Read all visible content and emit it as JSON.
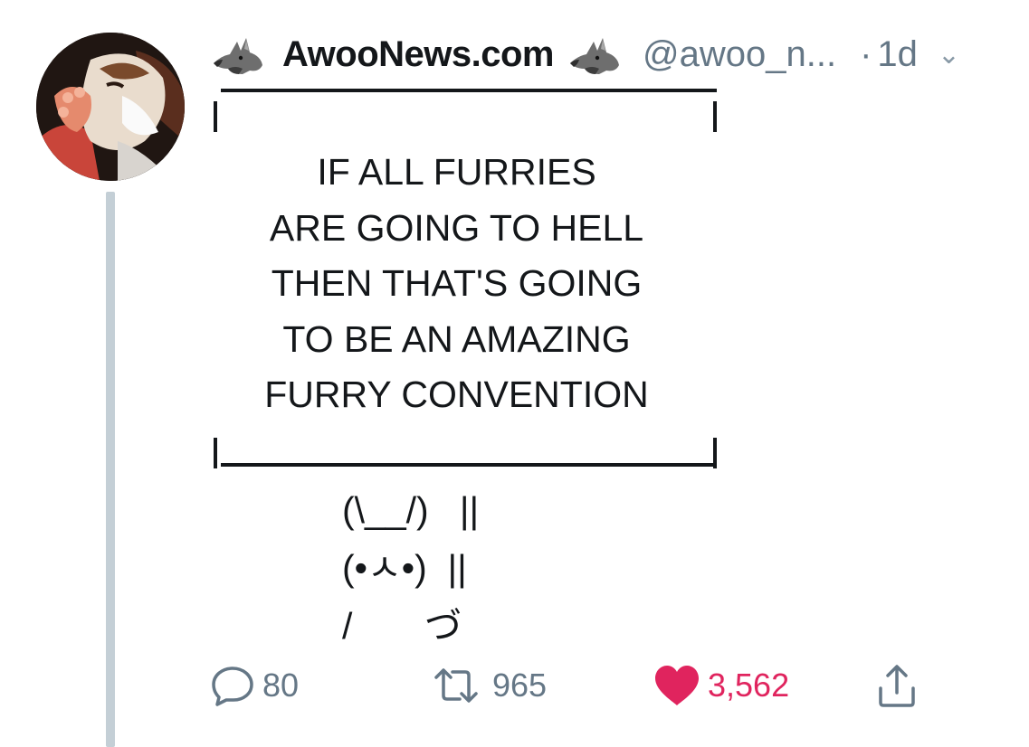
{
  "tweet": {
    "author": {
      "display_name": "AwooNews.com",
      "name_prefix_icon": "wolf-emoji-icon",
      "name_suffix_icon": "wolf-emoji-icon",
      "handle": "@awoo_n...",
      "separator": "·",
      "age": "1d",
      "avatar_icon": "furry-character-avatar"
    },
    "menu_icon": "chevron-down-icon",
    "body": {
      "sign_lines": [
        "IF ALL FURRIES",
        "ARE GOING TO HELL",
        "THEN THAT'S GOING",
        "TO BE AN AMAZING",
        "FURRY CONVENTION"
      ],
      "bunny_lines": [
        "(\\__/)   ||",
        "(•ㅅ•)  ||",
        "/       づ"
      ]
    },
    "actions": {
      "reply": {
        "icon": "reply-bubble-icon",
        "count": "80"
      },
      "retweet": {
        "icon": "retweet-icon",
        "count": "965"
      },
      "like": {
        "icon": "heart-icon",
        "count": "3,562",
        "liked": true,
        "color": "#e0245e"
      },
      "share": {
        "icon": "share-icon"
      }
    },
    "colors": {
      "muted": "#657786",
      "thread_line": "#c4cfd6",
      "like": "#e0245e"
    }
  }
}
